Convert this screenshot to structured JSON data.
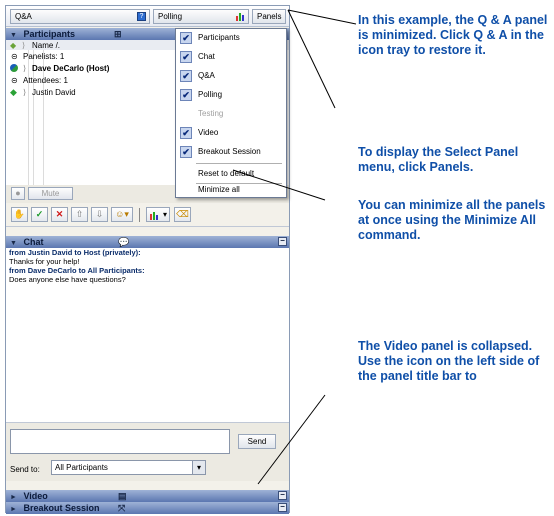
{
  "toolbar": {
    "qa_label": "Q&A",
    "polling_label": "Polling",
    "panels_label": "Panels"
  },
  "participants": {
    "title": "Participants",
    "name_header": "Name",
    "panelists_header": "Panelists: 1",
    "host_name": "Dave DeCarlo (Host)",
    "attendees_header": "Attendees: 1",
    "attendee_name": "Justin David",
    "mute_label": "Mute"
  },
  "panel_menu": {
    "items": [
      {
        "label": "Participants",
        "checked": true
      },
      {
        "label": "Chat",
        "checked": true
      },
      {
        "label": "Q&A",
        "checked": true
      },
      {
        "label": "Polling",
        "checked": true
      },
      {
        "label": "Testing",
        "checked": false,
        "disabled": true
      },
      {
        "label": "Video",
        "checked": true
      },
      {
        "label": "Breakout Session",
        "checked": true
      }
    ],
    "reset_label": "Reset to default",
    "minimize_label": "Minimize all"
  },
  "chat": {
    "title": "Chat",
    "messages": [
      {
        "from": "from Justin David to Host (privately):",
        "text": "Thanks for your help!"
      },
      {
        "from": "from Dave DeCarlo to All Participants:",
        "text": "Does anyone else have questions?"
      }
    ],
    "send_label": "Send",
    "send_to_label": "Send to:",
    "send_to_value": "All Participants"
  },
  "collapsed_panels": {
    "video": "Video",
    "breakout": "Breakout Session"
  },
  "callouts": {
    "qa": "In this example, the Q & A panel is minimized. Click Q & A in the icon tray to restore it.",
    "panels": "To display the Select Panel menu, click Panels.",
    "minimize": "You can minimize all the panels at once using the Minimize All command.",
    "video": "The Video panel is collapsed. Use the icon on the left side of the panel title bar to"
  },
  "colors": {
    "accent": "#0f4fa8",
    "panel_title": "#5b77b0"
  }
}
